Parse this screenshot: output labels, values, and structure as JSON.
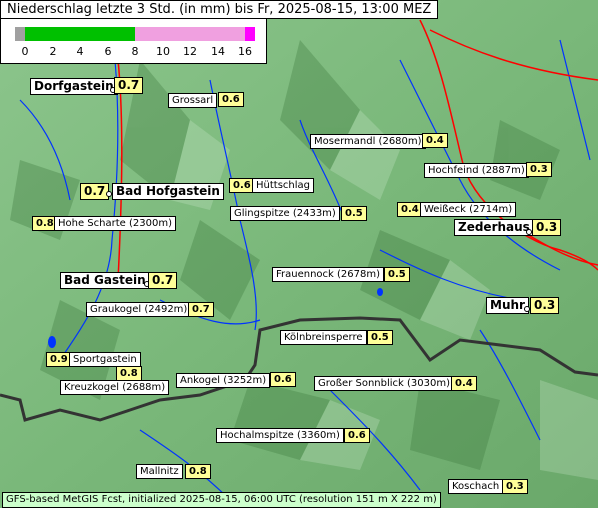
{
  "title": "Niederschlag letzte 3 Std. (in mm) bis Fr, 2025-08-15, 13:00 MEZ",
  "legend": {
    "ticks": [
      "0",
      "2",
      "4",
      "6",
      "8",
      "10",
      "12",
      "14",
      "16"
    ],
    "colors": {
      "none": "#a0a0a0",
      "low": "#00c000",
      "mid": "#80e080",
      "high": "#f0a0e0",
      "max": "#ff00ff"
    }
  },
  "places": [
    {
      "id": "dorfgastein",
      "name": "Dorfgastein",
      "value": "0.7"
    },
    {
      "id": "grossarl",
      "name": "Grossarl",
      "value": "0.6"
    },
    {
      "id": "mosermandl",
      "name": "Mosermandl (2680m)",
      "value": "0.4"
    },
    {
      "id": "hochfeind",
      "name": "Hochfeind (2887m)",
      "value": "0.3"
    },
    {
      "id": "bad-hofgastein",
      "name": "Bad Hofgastein",
      "value": "0.7"
    },
    {
      "id": "huettschlag",
      "name": "Hüttschlag",
      "value": "0.6"
    },
    {
      "id": "hohe-scharte",
      "name": "Hohe Scharte (2300m)",
      "value": "0.8"
    },
    {
      "id": "glingspitze",
      "name": "Glingspitze (2433m)",
      "value": "0.5"
    },
    {
      "id": "weisseck",
      "name": "Weißeck (2714m)",
      "value": "0.4"
    },
    {
      "id": "zederhaus",
      "name": "Zederhaus",
      "value": "0.3"
    },
    {
      "id": "frauennock",
      "name": "Frauennock (2678m)",
      "value": "0.5"
    },
    {
      "id": "bad-gastein",
      "name": "Bad Gastein",
      "value": "0.7"
    },
    {
      "id": "muhr",
      "name": "Muhr",
      "value": "0.3"
    },
    {
      "id": "graukogel",
      "name": "Graukogel (2492m)",
      "value": "0.7"
    },
    {
      "id": "koelnbreinsperre",
      "name": "Kölnbreinsperre",
      "value": "0.5"
    },
    {
      "id": "sportgastein",
      "name": "Sportgastein",
      "value": "0.9"
    },
    {
      "id": "kreuzkogel",
      "name": "Kreuzkogel (2688m)",
      "value": "0.8"
    },
    {
      "id": "ankogel",
      "name": "Ankogel (3252m)",
      "value": "0.6"
    },
    {
      "id": "grosser-sonnblick",
      "name": "Großer Sonnblick (3030m)",
      "value": "0.4"
    },
    {
      "id": "hochalmspitze",
      "name": "Hochalmspitze (3360m)",
      "value": "0.6"
    },
    {
      "id": "mallnitz",
      "name": "Mallnitz",
      "value": "0.8"
    },
    {
      "id": "koschach",
      "name": "Koschach",
      "value": "0.3"
    }
  ],
  "footer": "GFS-based MetGIS Fcst, initialized 2025-08-15, 06:00 UTC  (resolution 151 m X 222 m)",
  "colors": {
    "terrain": "#7ab87a",
    "terrain_dark": "#4e8f4e",
    "river": "#0033ff",
    "road": "#ff0000",
    "border": "#333333"
  }
}
